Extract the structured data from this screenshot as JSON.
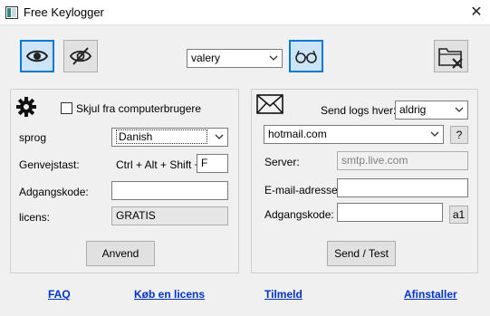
{
  "window": {
    "title": "Free Keylogger",
    "close_glyph": "✕"
  },
  "toolbar": {
    "user_select": {
      "value": "valery"
    },
    "icons": [
      "eye-icon",
      "eye-slash-icon",
      "glasses-icon",
      "folder-delete-icon"
    ]
  },
  "left_panel": {
    "hide_label": "Skjul fra computerbrugere",
    "hide_checked": false,
    "language_label": "sprog",
    "language_value": "Danish",
    "hotkey_label": "Genvejstast:",
    "hotkey_prefix": "Ctrl + Alt + Shift +",
    "hotkey_key": "F",
    "password_label": "Adgangskode:",
    "password_value": "",
    "license_label": "licens:",
    "license_value": "GRATIS",
    "apply_button": "Anvend"
  },
  "right_panel": {
    "send_logs_label": "Send logs hver:",
    "send_logs_value": "aldrig",
    "provider_value": "hotmail.com",
    "help_button": "?",
    "server_label": "Server:",
    "server_value": "smtp.live.com",
    "email_label": "E-mail-adresse:",
    "email_value": "",
    "password_label": "Adgangskode:",
    "password_value": "",
    "show_password_button": "a1",
    "send_test_button": "Send / Test"
  },
  "footer_links": {
    "faq": "FAQ",
    "buy_license": "Køb en licens",
    "signup": "Tilmeld",
    "uninstall": "Afinstaller"
  },
  "colors": {
    "accent": "#0078d7",
    "link": "#0033cc",
    "selected_fill": "#cce4f7"
  }
}
